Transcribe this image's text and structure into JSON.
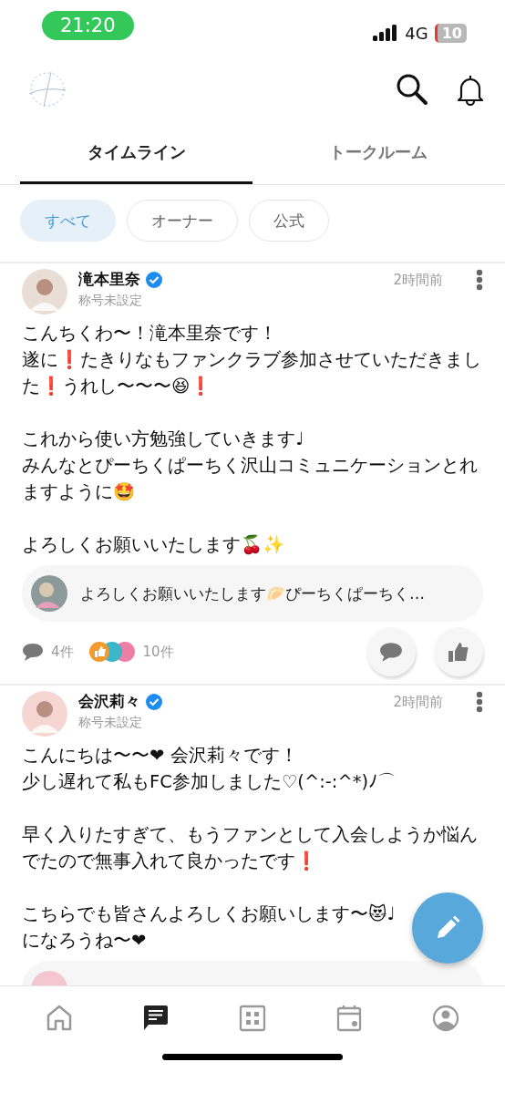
{
  "status_bar": {
    "time": "21:20",
    "network": "4G",
    "battery": "10"
  },
  "tabs": [
    {
      "label": "タイムライン",
      "selected": true
    },
    {
      "label": "トークルーム",
      "selected": false
    }
  ],
  "filters": [
    {
      "label": "すべて",
      "selected": true
    },
    {
      "label": "オーナー",
      "selected": false
    },
    {
      "label": "公式",
      "selected": false
    }
  ],
  "posts": [
    {
      "author": "滝本里奈",
      "verified": true,
      "title": "称号未設定",
      "time": "2時間前",
      "body": [
        [
          "こんちくわ〜！滝本里奈です！",
          "遂に❗たきりなもファンクラブ参加させていただきまし",
          "た❗うれし〜〜〜😆❗"
        ],
        [
          "これから使い方勉強していきます♩",
          "みんなとぴーちくぱーちく沢山コミュニケーションとれ",
          "ますように🤩"
        ],
        [
          "よろしくお願いいたします🍒✨"
        ]
      ],
      "comment_preview": {
        "text": "よろしくお願いいたします🥟ぴーちくぱーちく…"
      },
      "comment_count": "4件",
      "reaction_count": "10件"
    },
    {
      "author": "会沢莉々",
      "verified": true,
      "title": "称号未設定",
      "time": "2時間前",
      "body": [
        [
          "こんにちは〜〜❤ 会沢莉々です！",
          "少し遅れて私もFC参加しました♡(^:-:^*)ﾉ⌒"
        ],
        [
          "早く入りたすぎて、もうファンとして入会しようか悩ん",
          "でたので無事入れて良かったです❗"
        ],
        [
          "こちらでも皆さんよろしくお願いします〜😻♩",
          "になろうね〜❤"
        ]
      ]
    }
  ],
  "bottom_nav": [
    {
      "kind": "home",
      "selected": false
    },
    {
      "kind": "chat",
      "selected": true
    },
    {
      "kind": "grid",
      "selected": false
    },
    {
      "kind": "calendar",
      "selected": false
    },
    {
      "kind": "profile",
      "selected": false
    }
  ]
}
